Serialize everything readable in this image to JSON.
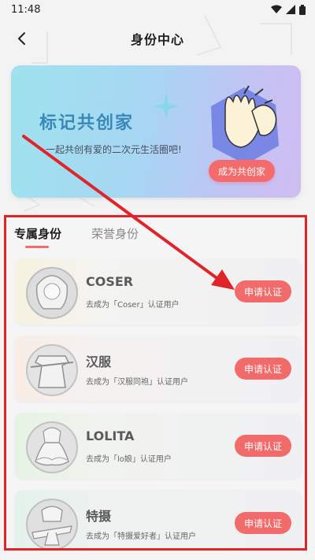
{
  "status_bar": {
    "time": "11:48"
  },
  "nav": {
    "title": "身份中心"
  },
  "banner": {
    "title": "标记共创家",
    "subtitle": "一起共创有爱的二次元生活圈吧!",
    "button_label": "成为共创家"
  },
  "tabs": [
    {
      "label": "专属身份",
      "active": true
    },
    {
      "label": "荣誉身份",
      "active": false
    }
  ],
  "cards": [
    {
      "title": "COSER",
      "desc": "去成为「Coser」认证用户",
      "button_label": "申请认证",
      "tint": "#f6f2e0"
    },
    {
      "title": "汉服",
      "desc": "去成为「汉服同袍」认证用户",
      "button_label": "申请认证",
      "tint": "#f9ede6"
    },
    {
      "title": "LOLITA",
      "desc": "去成为「lo娘」认证用户",
      "button_label": "申请认证",
      "tint": "#e6f3e3"
    },
    {
      "title": "特摄",
      "desc": "去成为「特摄爱好者」认证用户",
      "button_label": "申请认证",
      "tint": "#e4f2ec"
    }
  ],
  "colors": {
    "accent_red": "#f26b6b",
    "annotation_red": "#e0242a",
    "banner_title_blue": "#3a88b8"
  }
}
